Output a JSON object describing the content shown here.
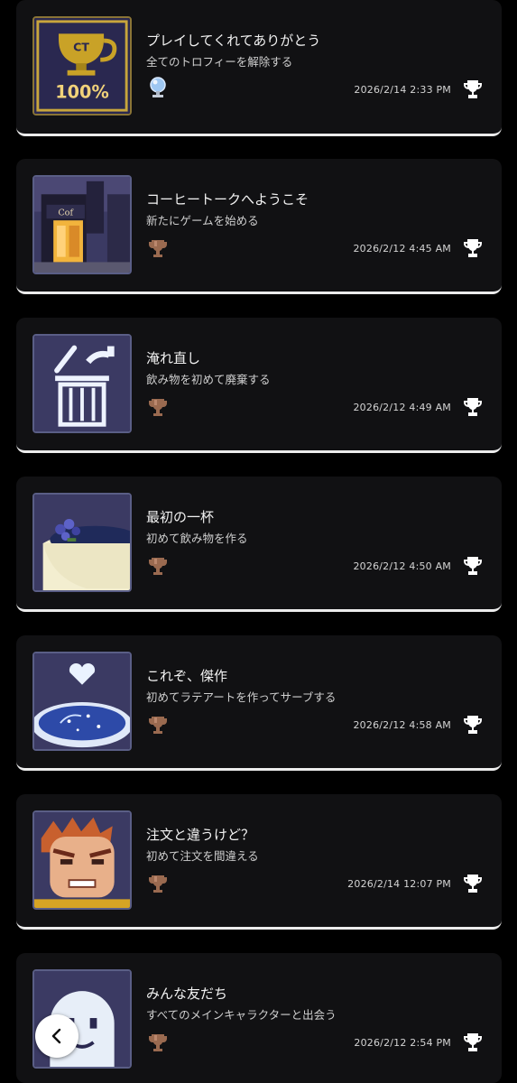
{
  "trophies": [
    {
      "title": "プレイしてくれてありがとう",
      "description": "全てのトロフィーを解除する",
      "date": "2026/2/14  2:33 PM",
      "grade": "platinum",
      "icon": "gold-cup-100-icon",
      "percent_label": "100%",
      "cup_label": "CT"
    },
    {
      "title": "コーヒートークへようこそ",
      "description": "新たにゲームを始める",
      "date": "2026/2/12  4:45 AM",
      "grade": "bronze",
      "icon": "cafe-night-street-icon",
      "sign_label": "Cof"
    },
    {
      "title": "淹れ直し",
      "description": "飲み物を初めて廃棄する",
      "date": "2026/2/12  4:49 AM",
      "grade": "bronze",
      "icon": "trash-can-icon"
    },
    {
      "title": "最初の一杯",
      "description": "初めて飲み物を作る",
      "date": "2026/2/12  4:50 AM",
      "grade": "bronze",
      "icon": "lavender-cup-icon"
    },
    {
      "title": "これぞ、傑作",
      "description": "初めてラテアートを作ってサーブする",
      "date": "2026/2/12  4:58 AM",
      "grade": "bronze",
      "icon": "latte-art-heart-icon"
    },
    {
      "title": "注文と違うけど？",
      "description": "初めて注文を間違える",
      "date": "2026/2/14  12:07 PM",
      "grade": "bronze",
      "icon": "angry-customer-icon"
    },
    {
      "title": "みんな友だち",
      "description": "すべてのメインキャラクターと出会う",
      "date": "2026/2/12  2:54 PM",
      "grade": "bronze",
      "icon": "ghost-face-icon"
    }
  ],
  "colors": {
    "platinum": "#9ec7f2",
    "bronze": "#9a6a50",
    "card_bg": "#111113",
    "separator": "#ececec"
  },
  "back_button": {
    "icon": "chevron-left-icon"
  }
}
